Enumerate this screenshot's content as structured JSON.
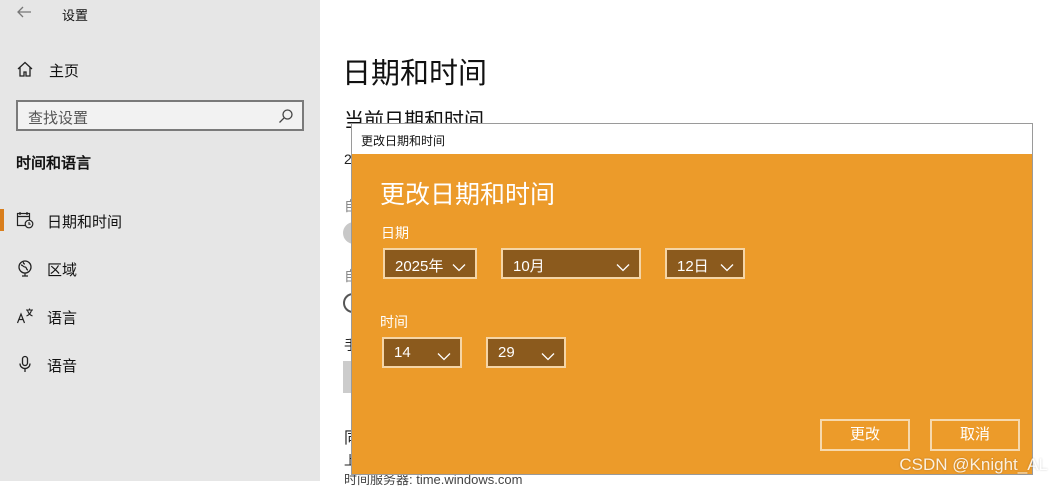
{
  "window": {
    "title": "设置"
  },
  "sidebar": {
    "home_label": "主页",
    "search_placeholder": "查找设置",
    "section_title": "时间和语言",
    "items": [
      {
        "label": "日期和时间",
        "icon": "calendar-clock-icon",
        "active": true
      },
      {
        "label": "区域",
        "icon": "globe-icon",
        "active": false
      },
      {
        "label": "语言",
        "icon": "language-icon",
        "active": false
      },
      {
        "label": "语音",
        "icon": "microphone-icon",
        "active": false
      }
    ]
  },
  "main": {
    "title": "日期和时间",
    "subtitle": "当前日期和时间",
    "peek": {
      "line1": "2",
      "line2": "自",
      "line3": "自",
      "line4": "手",
      "line5": "同",
      "line6": "上",
      "line7": "时间服务器: time.windows.com"
    }
  },
  "dialog": {
    "window_title": "更改日期和时间",
    "heading": "更改日期和时间",
    "date_label": "日期",
    "time_label": "时间",
    "year": "2025年",
    "month": "10月",
    "day": "12日",
    "hour": "14",
    "minute": "29",
    "change_button": "更改",
    "cancel_button": "取消"
  },
  "watermark": "CSDN @Knight_AL",
  "colors": {
    "accent": "#ec9b2a",
    "picker_bg": "#8b5a1d",
    "sidebar_bg": "#e6e6e6",
    "active_indicator": "#d97e1c"
  }
}
